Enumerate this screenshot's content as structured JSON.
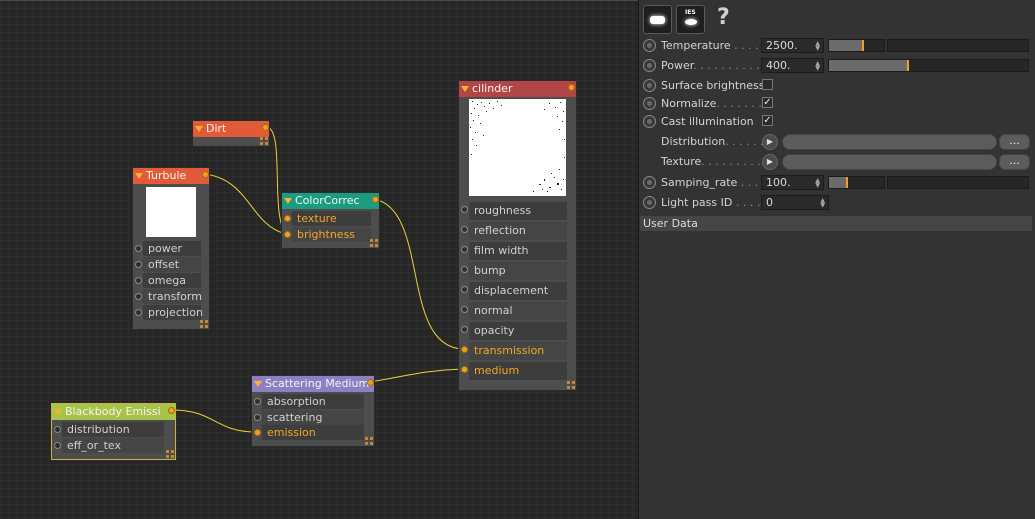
{
  "nodes": {
    "dirt": {
      "title": "Dirt",
      "color": "#e25a37"
    },
    "turbule": {
      "title": "Turbule",
      "color": "#e25a37",
      "inputs": [
        "power",
        "offset",
        "omega",
        "transform",
        "projection"
      ]
    },
    "color_correct": {
      "title": "ColorCorrec",
      "color": "#1b9b80",
      "inputs": [
        "texture",
        "brightness"
      ]
    },
    "cilinder": {
      "title": "cilinder",
      "color": "#b24545",
      "inputs": [
        "roughness",
        "reflection",
        "film width",
        "bump",
        "displacement",
        "normal",
        "opacity",
        "transmission",
        "medium"
      ]
    },
    "scattering_medium": {
      "title": "Scattering Medium",
      "color": "#8d7fc4",
      "inputs": [
        "absorption",
        "scattering",
        "emission"
      ]
    },
    "blackbody": {
      "title": "Blackbody Emissi",
      "color": "#a8c34a",
      "inputs": [
        "distribution",
        "eff_or_tex"
      ]
    }
  },
  "toolbar": {
    "icons": [
      "light-shape-icon",
      "ies-light-icon",
      "help-icon"
    ],
    "ies_text": "IES",
    "help_text": "?"
  },
  "attributes": {
    "temperature": {
      "label": "Temperature",
      "dots": " . . . . .",
      "value": "2500.",
      "slider_fraction": 0.5
    },
    "power": {
      "label": "Power",
      "dots": ". . . . . . . . . . .",
      "value": "400.",
      "slider_fraction": 0.5
    },
    "surface_brightness": {
      "label": "Surface brightness",
      "checked": false
    },
    "normalize": {
      "label": "Normalize",
      "dots": ". . . . . . . .",
      "checked": true
    },
    "cast_illumination": {
      "label": "Cast illumination",
      "checked": true
    },
    "distribution": {
      "label": "Distribution",
      "dots": ". . . . . . .",
      "more": "..."
    },
    "texture": {
      "label": "Texture",
      "dots": ". . . . . . . . . . .",
      "more": "..."
    },
    "samping_rate": {
      "label": "Samping_rate",
      "dots": " . . . .",
      "value": "100.",
      "slider_fraction": 0.3
    },
    "light_pass_id": {
      "label": "Light pass ID",
      "dots": " . . . . .",
      "value": "0"
    }
  },
  "user_data_header": "User Data",
  "colors": {
    "accent": "#f0a020",
    "wire": "#e8d23a",
    "connected_port": "#f4a623"
  }
}
